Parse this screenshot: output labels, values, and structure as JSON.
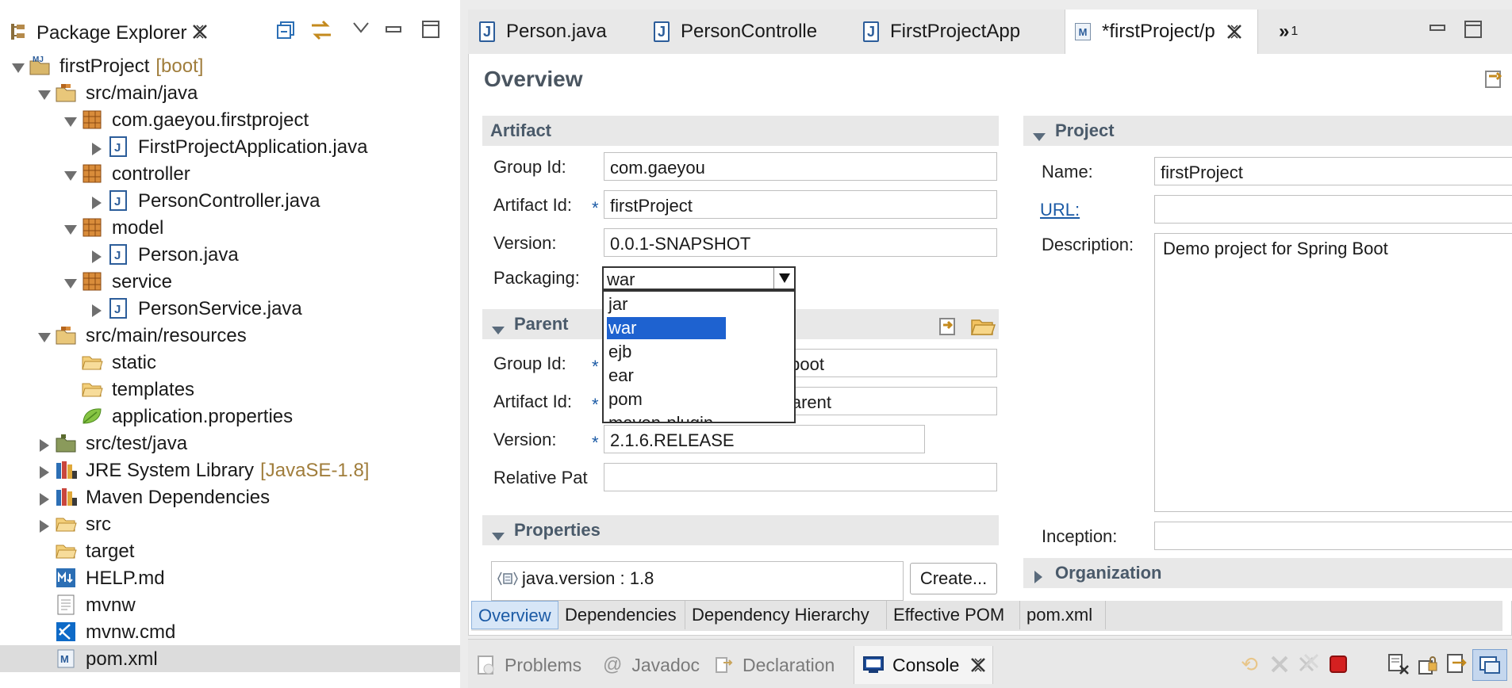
{
  "package_explorer": {
    "title": "Package Explorer",
    "tree": [
      {
        "label": "firstProject",
        "decoration": "[boot]",
        "icon": "maven-project-icon",
        "level": 0,
        "expanded": true
      },
      {
        "label": "src/main/java",
        "icon": "source-folder-icon",
        "level": 1,
        "expanded": true
      },
      {
        "label": "com.gaeyou.firstproject",
        "icon": "package-icon",
        "level": 2,
        "expanded": true
      },
      {
        "label": "FirstProjectApplication.java",
        "icon": "java-file-icon",
        "level": 3,
        "expanded": false
      },
      {
        "label": "controller",
        "icon": "package-icon",
        "level": 2,
        "expanded": true
      },
      {
        "label": "PersonController.java",
        "icon": "java-file-icon",
        "level": 3,
        "expanded": false
      },
      {
        "label": "model",
        "icon": "package-icon",
        "level": 2,
        "expanded": true
      },
      {
        "label": "Person.java",
        "icon": "java-file-icon",
        "level": 3,
        "expanded": false
      },
      {
        "label": "service",
        "icon": "package-icon",
        "level": 2,
        "expanded": true
      },
      {
        "label": "PersonService.java",
        "icon": "java-file-icon",
        "level": 3,
        "expanded": false
      },
      {
        "label": "src/main/resources",
        "icon": "source-folder-icon",
        "level": 1,
        "expanded": true
      },
      {
        "label": "static",
        "icon": "folder-icon",
        "level": 2,
        "leaf": true
      },
      {
        "label": "templates",
        "icon": "folder-icon",
        "level": 2,
        "leaf": true
      },
      {
        "label": "application.properties",
        "icon": "spring-leaf-icon",
        "level": 2,
        "leaf": true
      },
      {
        "label": "src/test/java",
        "icon": "test-folder-icon",
        "level": 1,
        "expanded": false
      },
      {
        "label": "JRE System Library",
        "decoration": "[JavaSE-1.8]",
        "icon": "library-icon",
        "level": 1,
        "expanded": false
      },
      {
        "label": "Maven Dependencies",
        "icon": "library-icon",
        "level": 1,
        "expanded": false
      },
      {
        "label": "src",
        "icon": "folder-icon",
        "level": 1,
        "expanded": false
      },
      {
        "label": "target",
        "icon": "folder-icon",
        "level": 1,
        "leaf": true
      },
      {
        "label": "HELP.md",
        "icon": "markdown-file-icon",
        "level": 1,
        "leaf": true
      },
      {
        "label": "mvnw",
        "icon": "text-file-icon",
        "level": 1,
        "leaf": true
      },
      {
        "label": "mvnw.cmd",
        "icon": "vscode-file-icon",
        "level": 1,
        "leaf": true
      },
      {
        "label": "pom.xml",
        "icon": "maven-pom-icon",
        "level": 1,
        "leaf": true,
        "selected": true
      }
    ]
  },
  "editor": {
    "tabs": [
      {
        "label": "Person.java",
        "icon": "java-file-icon"
      },
      {
        "label": "PersonControlle",
        "icon": "java-file-icon"
      },
      {
        "label": "FirstProjectApp",
        "icon": "java-file-icon"
      },
      {
        "label": "*firstProject/p",
        "icon": "maven-pom-icon",
        "active": true
      }
    ],
    "overflow_label": "»",
    "overflow_count": "1",
    "page_title": "Overview",
    "artifact": {
      "heading": "Artifact",
      "group_id_label": "Group Id:",
      "group_id": "com.gaeyou",
      "artifact_id_label": "Artifact Id:",
      "artifact_id": "firstProject",
      "version_label": "Version:",
      "version": "0.0.1-SNAPSHOT",
      "packaging_label": "Packaging:",
      "packaging": "war",
      "packaging_options": [
        "jar",
        "war",
        "ejb",
        "ear",
        "pom",
        "maven-plugin"
      ],
      "packaging_selected": "war"
    },
    "parent": {
      "heading": "Parent",
      "group_id_label": "Group Id:",
      "group_id_visible": "boot",
      "artifact_id_label": "Artifact Id:",
      "artifact_id_visible": "arent",
      "version_label": "Version:",
      "version": "2.1.6.RELEASE",
      "relative_path_label": "Relative Pat",
      "relative_path": ""
    },
    "properties": {
      "heading": "Properties",
      "items": [
        "java.version : 1.8"
      ],
      "create_button": "Create..."
    },
    "project": {
      "heading": "Project",
      "name_label": "Name:",
      "name": "firstProject",
      "url_label": "URL:",
      "url": "",
      "description_label": "Description:",
      "description": "Demo project for Spring Boot",
      "inception_label": "Inception:",
      "inception": ""
    },
    "organization": {
      "heading": "Organization"
    },
    "bottom_tabs": [
      "Overview",
      "Dependencies",
      "Dependency Hierarchy",
      "Effective POM",
      "pom.xml"
    ],
    "required_mark": "*"
  },
  "console_bar": {
    "tabs": [
      {
        "label": "Problems",
        "icon": "problems-icon"
      },
      {
        "label": "Javadoc",
        "icon": "at-icon"
      },
      {
        "label": "Declaration",
        "icon": "declaration-icon"
      },
      {
        "label": "Console",
        "icon": "console-icon",
        "active": true
      }
    ]
  },
  "colors": {
    "selection": "#1e62d0",
    "link": "#1b5aa5",
    "decoration": "#a07d3b",
    "terminate": "#d42020"
  }
}
